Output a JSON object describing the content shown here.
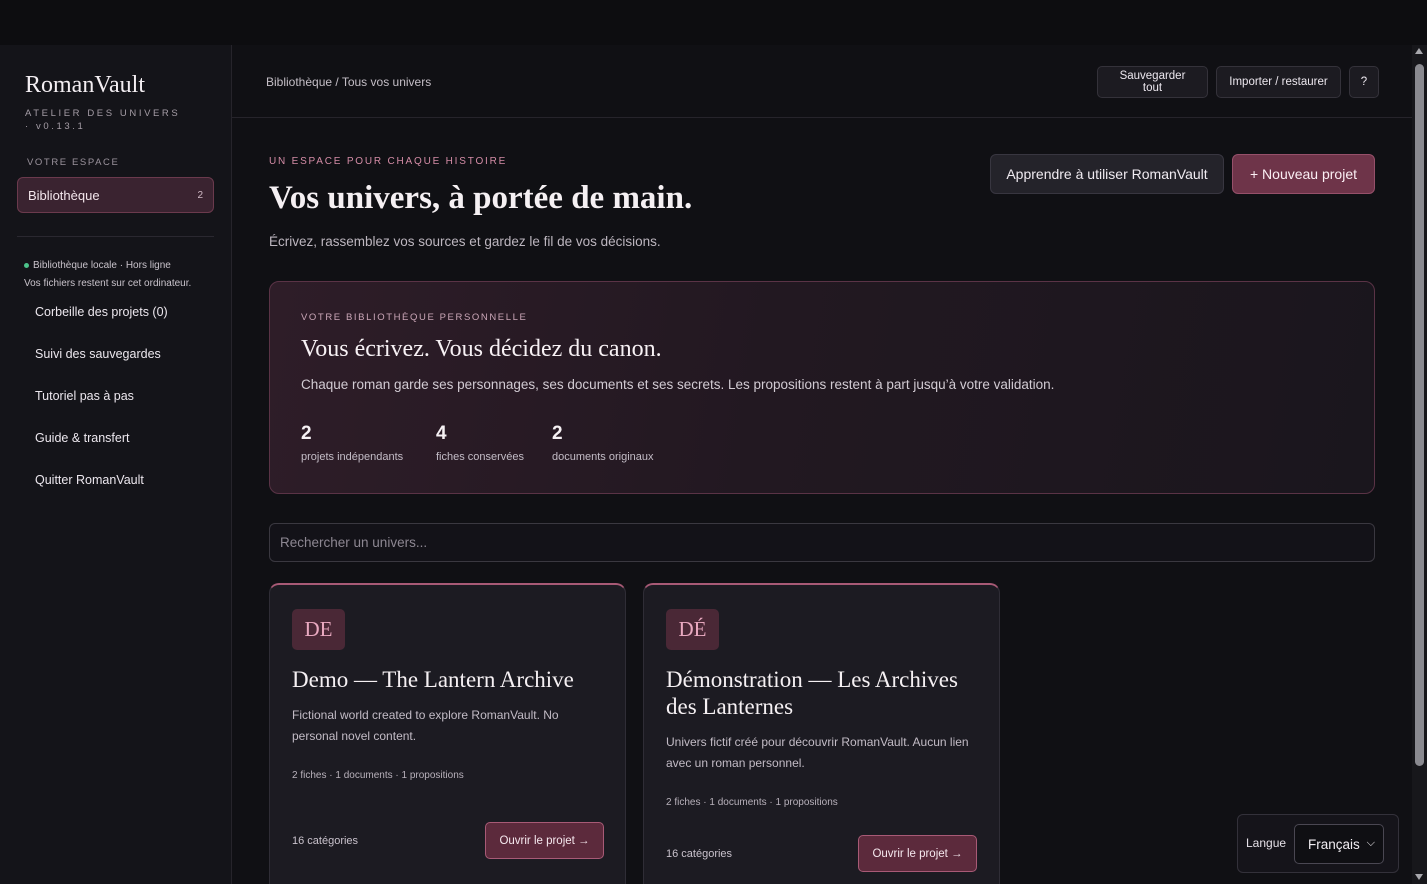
{
  "sidebar": {
    "brand": "RomanVault",
    "brand_sub": "ATELIER DES UNIVERS · v0.13.1",
    "section_label": "VOTRE ESPACE",
    "active_item": {
      "label": "Bibliothèque",
      "count": "2"
    },
    "status_line1": "Bibliothèque locale · Hors ligne",
    "status_line2": "Vos fichiers restent sur cet ordinateur.",
    "links": [
      "Corbeille des projets (0)",
      "Suivi des sauvegardes",
      "Tutoriel pas à pas",
      "Guide & transfert",
      "Quitter RomanVault"
    ]
  },
  "header": {
    "breadcrumb": "Bibliothèque / Tous vos univers",
    "save_all": "Sauvegarder tout",
    "import_restore": "Importer / restaurer",
    "help": "?"
  },
  "hero": {
    "eyebrow": "UN ESPACE POUR CHAQUE HISTOIRE",
    "title": "Vos univers, à portée de main.",
    "subtitle": "Écrivez, rassemblez vos sources et gardez le fil de vos décisions.",
    "learn_button": "Apprendre à utiliser RomanVault",
    "new_button": "+ Nouveau projet"
  },
  "panel": {
    "eyebrow": "VOTRE BIBLIOTHÈQUE PERSONNELLE",
    "title": "Vous écrivez. Vous décidez du canon.",
    "text": "Chaque roman garde ses personnages, ses documents et ses secrets. Les propositions restent à part jusqu’à votre validation.",
    "stats": [
      {
        "value": "2",
        "label": "projets indépendants"
      },
      {
        "value": "4",
        "label": "fiches conservées"
      },
      {
        "value": "2",
        "label": "documents originaux"
      }
    ]
  },
  "search": {
    "placeholder": "Rechercher un univers..."
  },
  "projects": [
    {
      "initials": "DE",
      "title": "Demo — The Lantern Archive",
      "description": "Fictional world created to explore RomanVault. No personal novel content.",
      "meta": "2 fiches · 1 documents · 1 propositions",
      "categories": "16 catégories",
      "open": "Ouvrir le projet →"
    },
    {
      "initials": "DÉ",
      "title": "Démonstration — Les Archives des Lanternes",
      "description": "Univers fictif créé pour découvrir RomanVault. Aucun lien avec un roman personnel.",
      "meta": "2 fiches · 1 documents · 1 propositions",
      "categories": "16 catégories",
      "open": "Ouvrir le projet →"
    }
  ],
  "language": {
    "label": "Langue",
    "selected": "Français"
  },
  "colors": {
    "accent": "#6e3449",
    "accent_border": "#a85a76",
    "eyebrow": "#d48ca6",
    "status_dot": "#4cc38a"
  }
}
